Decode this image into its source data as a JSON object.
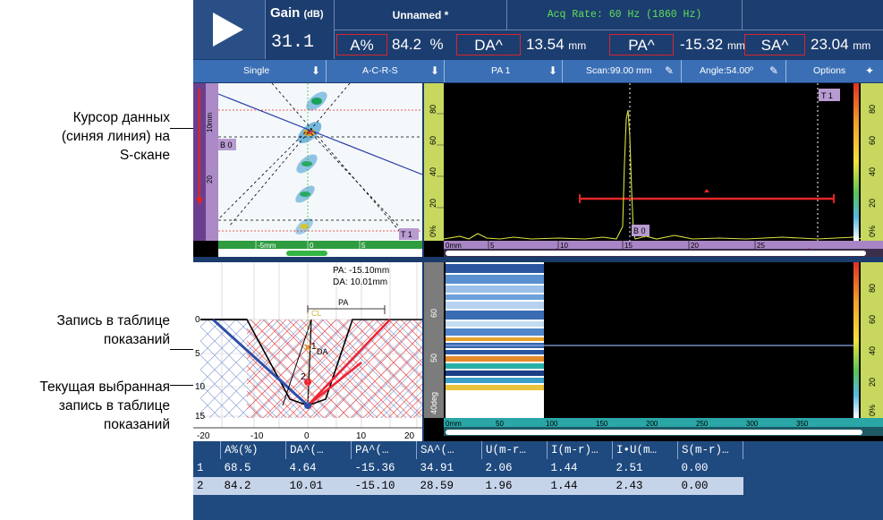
{
  "annotations": {
    "cursor": "Курсор данных\n(синяя линия) на\nS-скане",
    "entry": "Запись в таблице\nпоказаний",
    "current": "Текущая выбранная\nзапись в таблице\nпоказаний"
  },
  "header": {
    "gain_title": "Gain",
    "gain_unit": "(dB)",
    "gain_value": "31.1",
    "doc_title": "Unnamed *",
    "acq_rate": "Acq Rate: 60 Hz (1860 Hz)",
    "readings": [
      {
        "label": "A%",
        "value": "84.2",
        "unit": "%"
      },
      {
        "label": "DA^",
        "value": "13.54",
        "unit": "mm"
      },
      {
        "label": "PA^",
        "value": "-15.32",
        "unit": "mm"
      },
      {
        "label": "SA^",
        "value": "23.04",
        "unit": "mm"
      }
    ]
  },
  "toolbar": {
    "items": [
      {
        "label": "Single",
        "icon": "download-arrow-icon"
      },
      {
        "label": "A-C-R-S",
        "icon": "download-arrow-icon"
      },
      {
        "label": "PA 1",
        "icon": "download-arrow-icon"
      },
      {
        "label": "Scan:99.00 mm",
        "icon": "pencil-icon"
      },
      {
        "label": "Angle:54.00º",
        "icon": "pencil-icon"
      },
      {
        "label": "Options",
        "icon": "tools-icon"
      }
    ]
  },
  "sscan": {
    "gate_b": "B 0",
    "gate_t": "T 1",
    "ruler_ticks": [
      "10mm",
      "20"
    ],
    "x_ticks": [
      "-5mm",
      "0",
      "5"
    ]
  },
  "ascan": {
    "gate_t": "T 1",
    "gate_b": "B 0",
    "y_ticks": [
      "80",
      "60",
      "40",
      "20",
      "0%"
    ],
    "x_ticks": [
      "0mm",
      "5",
      "10",
      "15",
      "20",
      "25"
    ],
    "color_ticks": [
      "80",
      "60",
      "40",
      "20",
      "0%"
    ]
  },
  "plot": {
    "pa_label": "PA: -15.10mm",
    "da_label": "DA: 10.01mm",
    "pa_marker": "PA",
    "cl_marker": "CL",
    "da_marker": "DA",
    "point_1": "1",
    "point_2": "2",
    "y_ticks": [
      "0",
      "5",
      "10",
      "15"
    ],
    "x_ticks": [
      "-20",
      "-10",
      "0",
      "10",
      "20"
    ]
  },
  "cscan": {
    "y_ticks": [
      "60",
      "50",
      "40deg"
    ],
    "x_ticks": [
      "0mm",
      "50",
      "100",
      "150",
      "200",
      "250",
      "300",
      "350"
    ],
    "color_ticks": [
      "80",
      "60",
      "40",
      "20",
      "0%"
    ]
  },
  "table": {
    "headers": [
      "",
      "A%(%)",
      "DA^(…",
      "PA^(…",
      "SA^(…",
      "U(m-r…",
      "I(m-r)…",
      "I•U(m…",
      "S(m-r)…"
    ],
    "rows": [
      [
        "1",
        "68.5",
        "4.64",
        "-15.36",
        "34.91",
        "2.06",
        "1.44",
        "2.51",
        "0.00"
      ],
      [
        "2",
        "84.2",
        "10.01",
        "-15.10",
        "28.59",
        "1.96",
        "1.44",
        "2.43",
        "0.00"
      ]
    ]
  }
}
